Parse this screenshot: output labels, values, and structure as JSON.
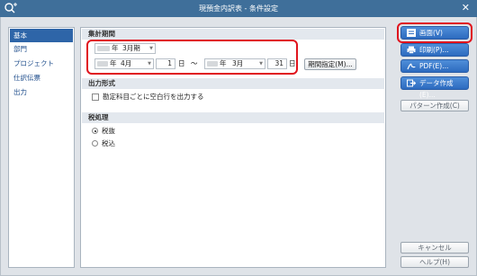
{
  "window": {
    "title": "現預金内訳表 - 条件設定"
  },
  "sidebar": {
    "items": [
      {
        "label": "基本"
      },
      {
        "label": "部門"
      },
      {
        "label": "プロジェクト"
      },
      {
        "label": "仕訳伝票"
      },
      {
        "label": "出力"
      }
    ]
  },
  "aggregation": {
    "header": "集計期間",
    "fiscal_year_suffix": "年",
    "term": "3月期",
    "from_year_suffix": "年",
    "from_month": "4月",
    "from_day": "1",
    "day_unit": "日",
    "range_sep": "～",
    "to_year_suffix": "年",
    "to_month": "3月",
    "to_day": "31",
    "period_button": "期間指定(M)..."
  },
  "output_format": {
    "header": "出力形式",
    "blank_row_label": "勘定科目ごとに空白行を出力する",
    "blank_row_checked": false
  },
  "tax": {
    "header": "税処理",
    "options": [
      {
        "label": "税抜",
        "selected": true
      },
      {
        "label": "税込",
        "selected": false
      }
    ]
  },
  "actions": {
    "screen": "画面(V)",
    "print": "印刷(P)...",
    "pdf": "PDF(E)...",
    "data_create": "データ作成(E)...",
    "pattern_create": "パターン作成(C)",
    "cancel": "キャンセル",
    "help": "ヘルプ(H)"
  },
  "colors": {
    "accent": "#2d6bbf",
    "highlight": "#e0141e",
    "titlebar": "#3f6f9a"
  }
}
